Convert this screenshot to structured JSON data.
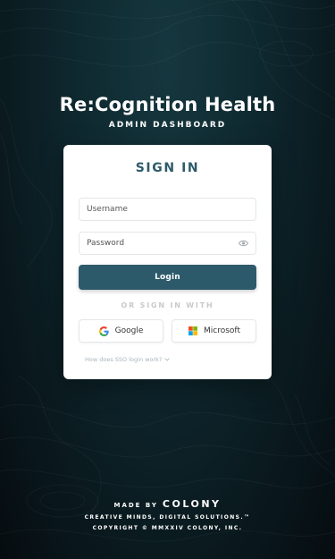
{
  "brand": {
    "title": "Re:Cognition Health",
    "subtitle": "ADMIN DASHBOARD"
  },
  "signin": {
    "title": "SIGN IN",
    "username_placeholder": "Username",
    "username_value": "",
    "password_placeholder": "Password",
    "password_value": "",
    "login_label": "Login",
    "divider": "OR SIGN IN WITH",
    "google_label": "Google",
    "microsoft_label": "Microsoft",
    "help_text": "How does SSO login work?"
  },
  "footer": {
    "made_by": "MADE BY",
    "company": "COLONY",
    "tagline": "CREATIVE MINDS, DIGITAL SOLUTIONS.™",
    "copyright": "COPYRIGHT © MMXXIV COLONY, INC."
  },
  "icons": {
    "password_toggle": "eye-icon",
    "google": "google-icon",
    "microsoft": "microsoft-icon",
    "help_toggle": "chevron-down-icon"
  },
  "colors": {
    "primary": "#2d5a6b",
    "background": "#0f2a31",
    "card": "#ffffff",
    "microsoft_red": "#f25022",
    "microsoft_green": "#7fba00",
    "microsoft_blue": "#00a4ef",
    "microsoft_yellow": "#ffb900"
  }
}
